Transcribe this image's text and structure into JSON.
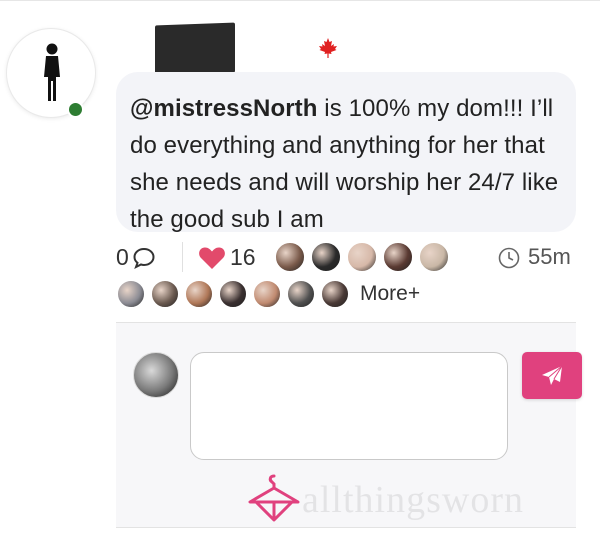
{
  "post": {
    "author_avatar_icon": "person-figure-icon",
    "country_flag_icon": "canada-maple-leaf-icon",
    "mention": "@mistressNorth",
    "text_rest": " is 100% my dom!!! I’ll do everything and anything for her that she needs and will worship her 24/7 like the good sub I am"
  },
  "stats": {
    "comment_count": "0",
    "like_count": "16",
    "time_ago": "55m",
    "more_label": "More+"
  },
  "likers_row1": [
    "#7a5a4a",
    "#2a2a2a",
    "#d6b8a8",
    "#5a3a32",
    "#c9b7a6"
  ],
  "likers_row2": [
    "#8c8c94",
    "#6b5a50",
    "#b07858",
    "#3a3030",
    "#c08a70",
    "#505050",
    "#4a3a36"
  ],
  "reply": {
    "placeholder": "",
    "send_icon": "paper-plane-icon"
  },
  "watermark": {
    "text": "allthingsworn",
    "logo_icon": "hanger-logo-icon"
  },
  "colors": {
    "accent": "#e0417e",
    "online": "#2e7d32",
    "heart": "#e24a6b",
    "bubble": "#f3f4f8"
  }
}
